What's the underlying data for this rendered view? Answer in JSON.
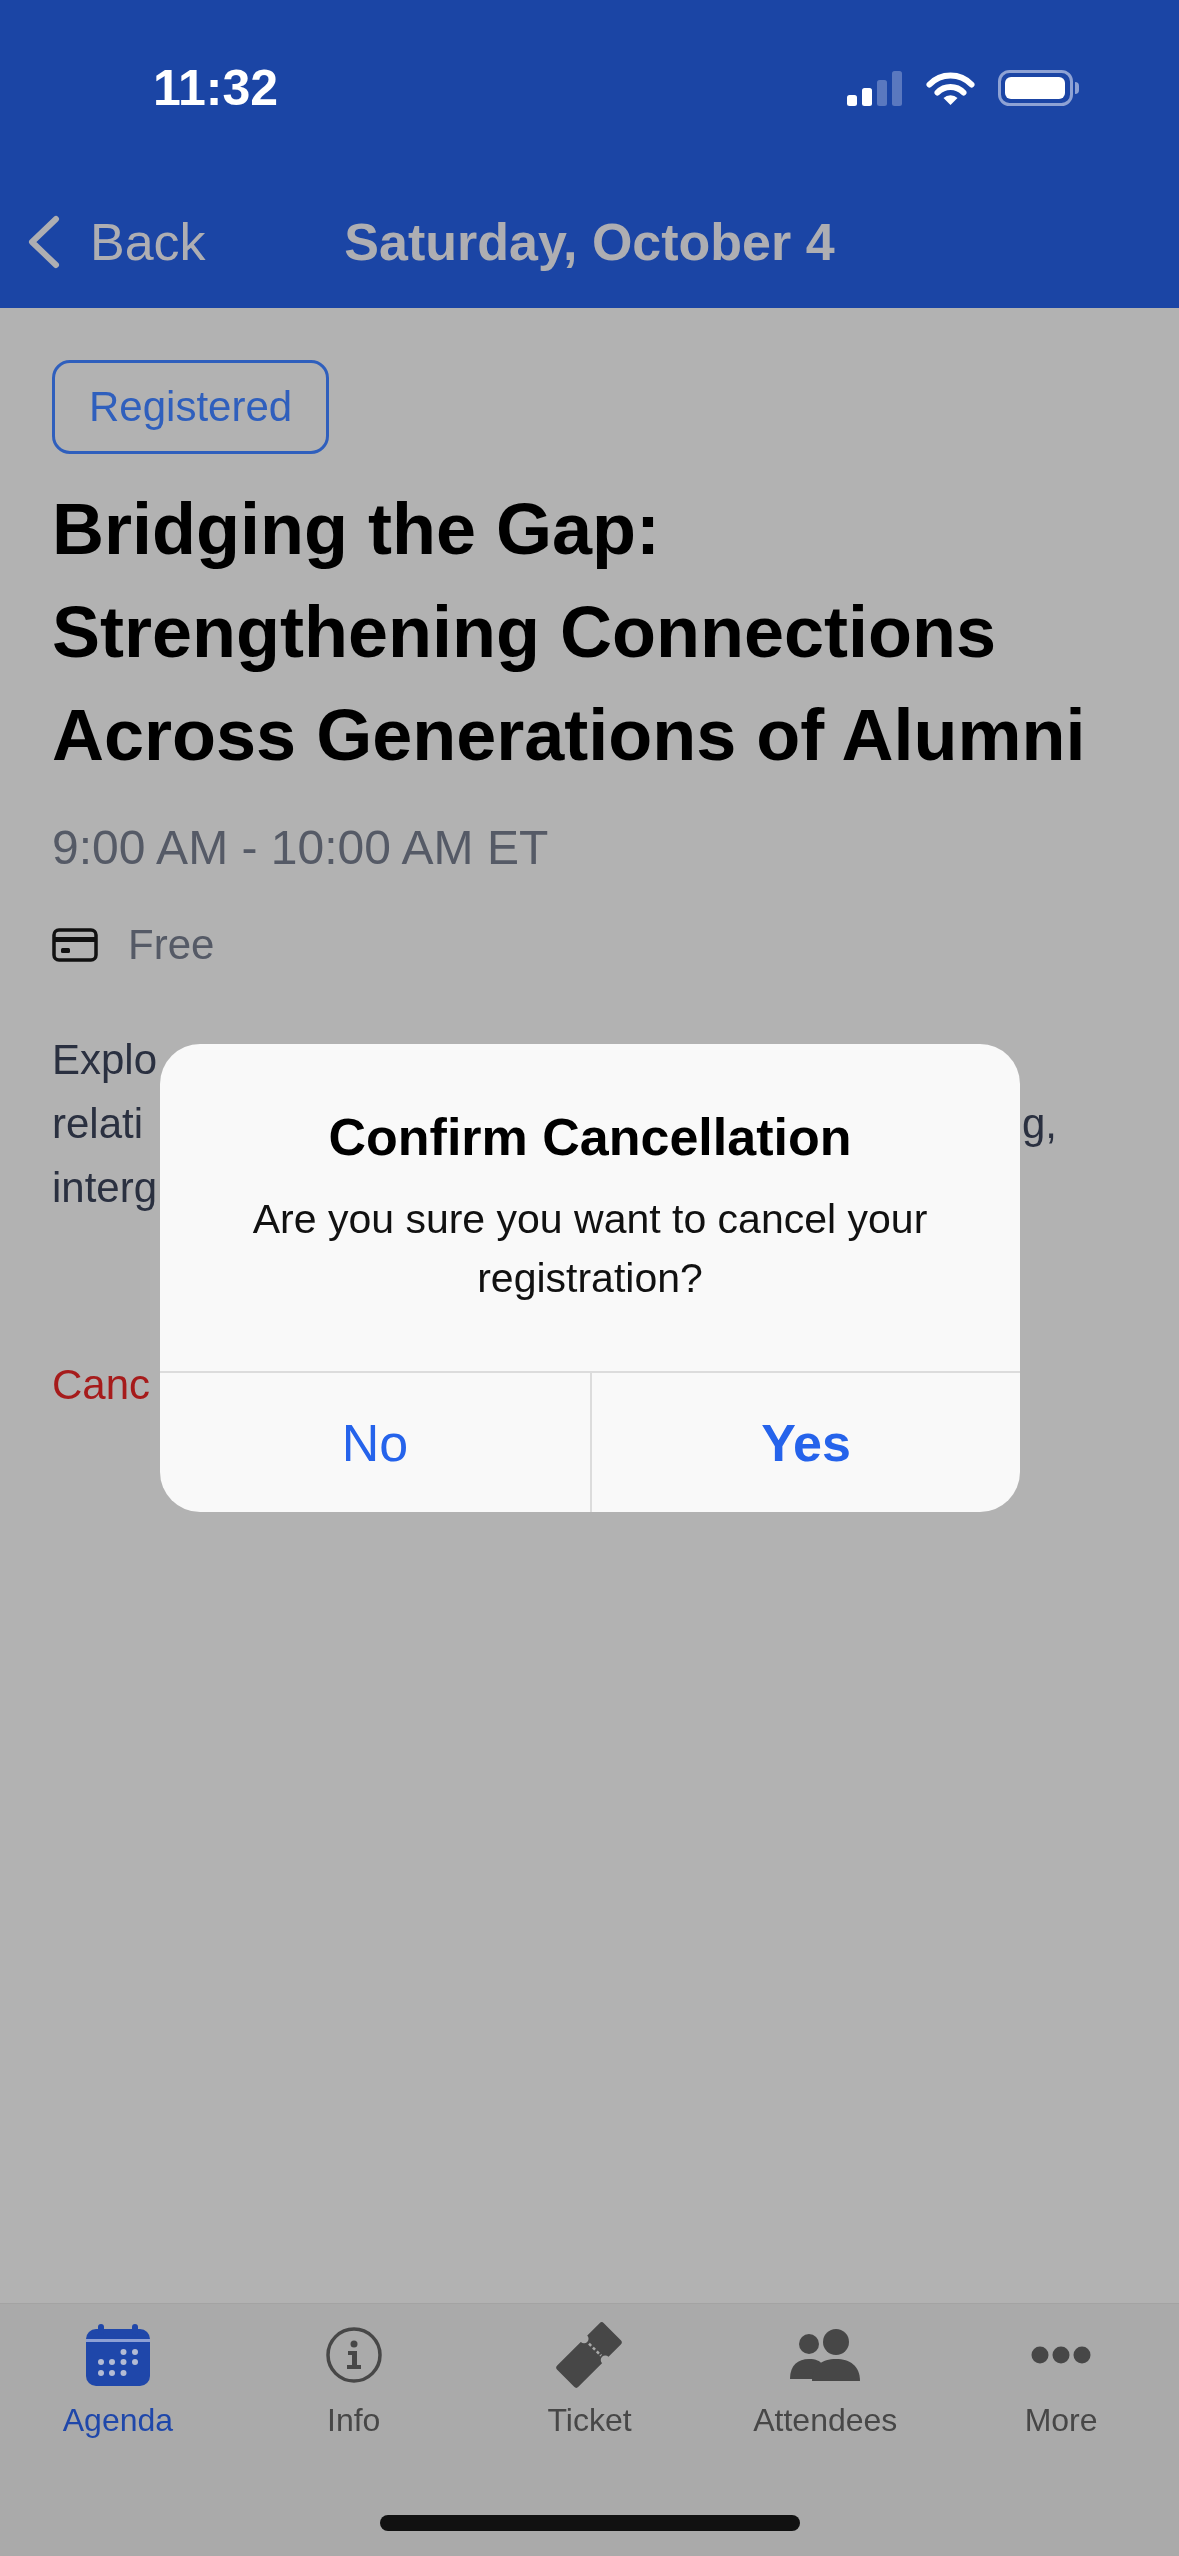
{
  "status_bar": {
    "time": "11:32"
  },
  "nav_bar": {
    "back_label": "Back",
    "title": "Saturday, October 4"
  },
  "event": {
    "status_badge": "Registered",
    "title": "Bridging the Gap: Strengthening Connections Across Generations of Alumni",
    "time": "9:00 AM - 10:00 AM ET",
    "price": "Free",
    "description_lines": [
      {
        "start": "Explo"
      },
      {
        "start": "relati",
        "end": "g,"
      },
      {
        "start": "interg"
      }
    ],
    "cancel_link": "Canc"
  },
  "dialog": {
    "title": "Confirm Cancellation",
    "message": "Are you sure you want to cancel your registration?",
    "buttons": [
      {
        "label": "No",
        "kind": "cancel"
      },
      {
        "label": "Yes",
        "kind": "default"
      }
    ]
  },
  "tabs": [
    {
      "label": "Agenda",
      "selected": true
    },
    {
      "label": "Info",
      "selected": false
    },
    {
      "label": "Ticket",
      "selected": false
    },
    {
      "label": "Attendees",
      "selected": false
    },
    {
      "label": "More",
      "selected": false
    }
  ]
}
